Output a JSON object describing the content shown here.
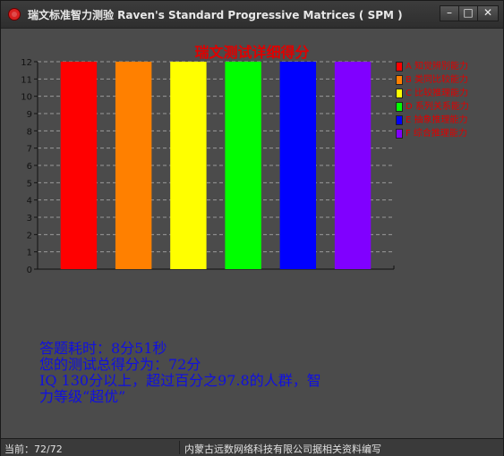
{
  "window": {
    "title": "瑞文标准智力测验 Raven's Standard Progressive Matrices ( SPM )",
    "min_label": "–",
    "max_label": "□",
    "close_label": "✕"
  },
  "chart_data": {
    "type": "bar",
    "title": "瑞文测试详细得分",
    "categories": [
      "A 知觉辨别能力",
      "B 类同比较能力",
      "C 比较推理能力",
      "D 系列关系能力",
      "E 抽象推理能力",
      "F 综合推理能力"
    ],
    "values": [
      12,
      12,
      12,
      12,
      12,
      12
    ],
    "colors": [
      "#ff0000",
      "#ff8000",
      "#ffff00",
      "#00ff00",
      "#0000ff",
      "#8000ff"
    ],
    "ylim": [
      0,
      12
    ],
    "yticks": [
      0,
      1,
      2,
      3,
      4,
      5,
      6,
      7,
      8,
      9,
      10,
      11,
      12
    ],
    "grid": true,
    "legend_position": "right"
  },
  "legend": [
    {
      "label": "A 知觉辨别能力",
      "color": "#ff0000"
    },
    {
      "label": "B 类同比较能力",
      "color": "#ff8000"
    },
    {
      "label": "C 比较推理能力",
      "color": "#ffff00"
    },
    {
      "label": "D 系列关系能力",
      "color": "#00ff00"
    },
    {
      "label": "E 抽象推理能力",
      "color": "#0000ff"
    },
    {
      "label": "F 综合推理能力",
      "color": "#8000ff"
    }
  ],
  "info": {
    "time": "答题耗时：8分51秒",
    "score": "您的测试总得分为：72分",
    "iq_line1": "IQ 130分以上，超过百分之97.8的人群，智",
    "iq_line2": "力等级“超优”"
  },
  "status": {
    "progress": "当前：72/72",
    "credit": "内蒙古远数网络科技有限公司据相关资料编写"
  }
}
